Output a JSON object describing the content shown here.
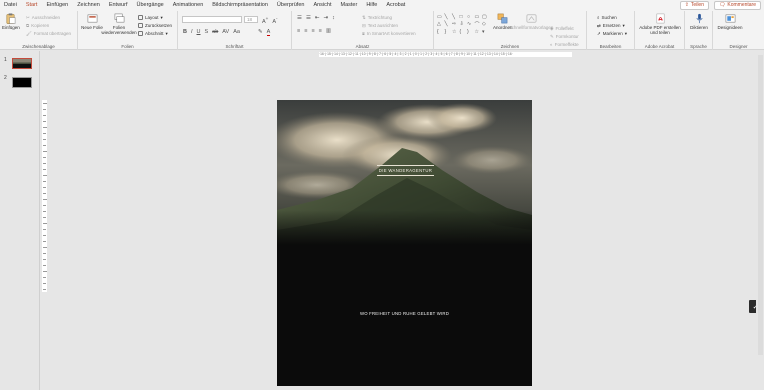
{
  "menu": {
    "items": [
      "Datei",
      "Start",
      "Einfügen",
      "Zeichnen",
      "Entwurf",
      "Übergänge",
      "Animationen",
      "Bildschirmpräsentation",
      "Überprüfen",
      "Ansicht",
      "Master",
      "Hilfe",
      "Acrobat"
    ],
    "active": "Start",
    "share_label": "Teilen",
    "comments_label": "Kommentare"
  },
  "ribbon": {
    "clipboard": {
      "paste_label": "Einfügen",
      "cut_label": "Ausschneiden",
      "copy_label": "Kopieren",
      "format_painter_label": "Format übertragen",
      "group_label": "Zwischenablage"
    },
    "slides": {
      "new_slide_label": "Neue Folie",
      "reuse_label": "Folien wiederverwenden",
      "layout_label": "Layout",
      "reset_label": "Zurücksetzen",
      "section_label": "Abschnitt",
      "group_label": "Folien"
    },
    "font": {
      "group_label": "Schriftart",
      "size_value": "18"
    },
    "paragraph": {
      "text_direction_label": "Textrichtung",
      "align_text_label": "Text ausrichten",
      "smartart_label": "In SmartArt konvertieren",
      "group_label": "Absatz"
    },
    "drawing": {
      "arrange_label": "Anordnen",
      "quick_styles_label": "Schnellformatvorlagen",
      "fill_label": "Fülleffekt",
      "outline_label": "Formkontur",
      "effects_label": "Formeffekte",
      "group_label": "Zeichnen"
    },
    "editing": {
      "find_label": "Suchen",
      "replace_label": "Ersetzen",
      "select_label": "Markieren",
      "group_label": "Bearbeiten"
    },
    "acrobat": {
      "create_pdf_label": "Adobe PDF erstellen und teilen",
      "group_label": "Adobe Acrobat"
    },
    "voice": {
      "dictate_label": "Diktieren",
      "group_label": "Sprache"
    },
    "designer": {
      "design_ideas_label": "Designideen",
      "group_label": "Designer"
    }
  },
  "thumbnails": [
    {
      "number": "1"
    },
    {
      "number": "2"
    }
  ],
  "ruler": {
    "text": "·16·|·15·|·14·|·13·|·12·|·11·|·10·|·9·|·8·|·7·|·6·|·5·|·4·|·3·|·2·|·1·|·0·|·1·|·2·|·3·|·4·|·5·|·6·|·7·|·8·|·9·|·10·|·11·|·12·|·13·|·14·|·15·|·16·"
  },
  "slide": {
    "title": "DIE WANDERAGENTUR",
    "tagline": "WO FREIHEIT UND RUHE GELEBT WIRD"
  },
  "colors": {
    "accent": "#b7472a",
    "ribbon_bg": "#f3f3f3",
    "canvas_bg": "#e6e6e6",
    "slide_bg": "#0b0b0b"
  },
  "icons": {
    "check": "check-icon"
  }
}
